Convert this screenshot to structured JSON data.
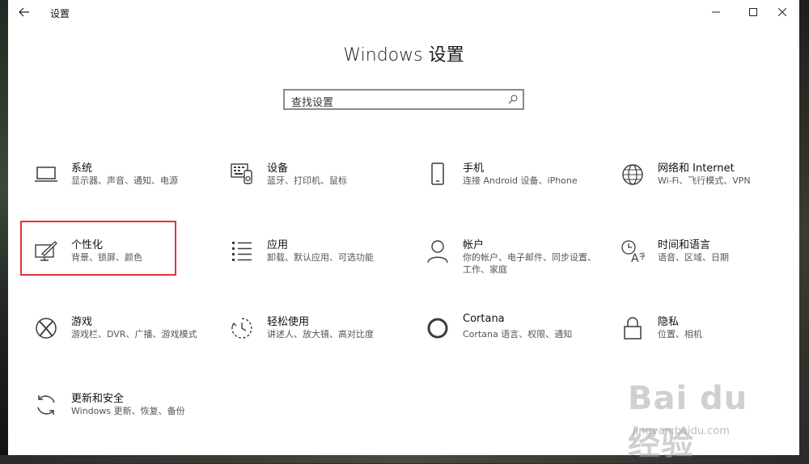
{
  "window": {
    "app_title": "设置",
    "main_title": "Windows 设置"
  },
  "search": {
    "placeholder": "查找设置"
  },
  "tiles": [
    {
      "title": "系统",
      "desc": "显示器、声音、通知、电源",
      "icon": "laptop-icon"
    },
    {
      "title": "设备",
      "desc": "蓝牙、打印机、鼠标",
      "icon": "keyboard-icon"
    },
    {
      "title": "手机",
      "desc": "连接 Android 设备、iPhone",
      "icon": "phone-icon"
    },
    {
      "title": "网络和 Internet",
      "desc": "Wi-Fi、飞行模式、VPN",
      "icon": "globe-icon"
    },
    {
      "title": "个性化",
      "desc": "背景、锁屏、颜色",
      "icon": "paint-icon"
    },
    {
      "title": "应用",
      "desc": "卸载、默认应用、可选功能",
      "icon": "app-list-icon"
    },
    {
      "title": "帐户",
      "desc": "你的帐户、电子邮件、同步设置、工作、家庭",
      "icon": "person-icon"
    },
    {
      "title": "时间和语言",
      "desc": "语音、区域、日期",
      "icon": "time-language-icon"
    },
    {
      "title": "游戏",
      "desc": "游戏栏、DVR、广播、游戏模式",
      "icon": "xbox-icon"
    },
    {
      "title": "轻松使用",
      "desc": "讲述人、放大镜、高对比度",
      "icon": "ease-of-access-icon"
    },
    {
      "title": "Cortana",
      "desc": "Cortana 语言、权限、通知",
      "icon": "cortana-icon"
    },
    {
      "title": "隐私",
      "desc": "位置、相机",
      "icon": "lock-icon"
    },
    {
      "title": "更新和安全",
      "desc": "Windows 更新、恢复、备份",
      "icon": "sync-icon"
    }
  ],
  "watermark": {
    "main": "Bai du 经验",
    "sub": "jingyan.baidu.com"
  },
  "colors": {
    "highlight": "#e0343a",
    "icon": "#3c3c3c"
  }
}
